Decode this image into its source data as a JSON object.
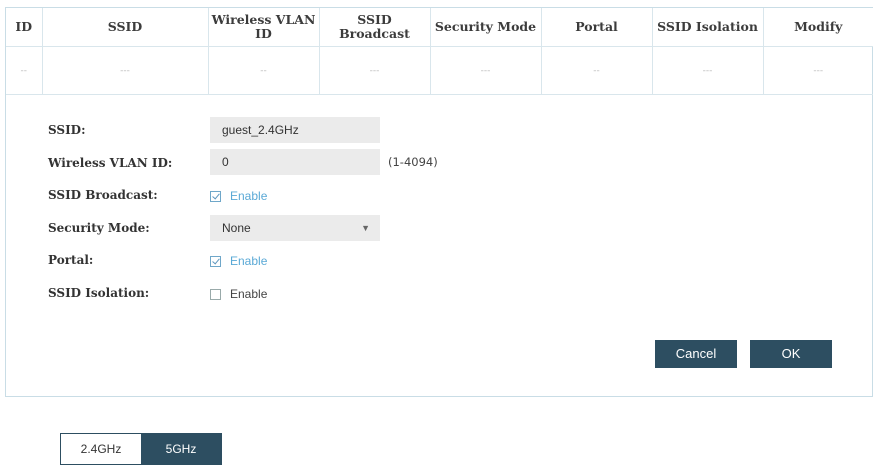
{
  "table": {
    "headers": [
      "ID",
      "SSID",
      "Wireless VLAN ID",
      "SSID Broadcast",
      "Security Mode",
      "Portal",
      "SSID Isolation",
      "Modify"
    ],
    "row": [
      "--",
      "---",
      "--",
      "---",
      "---",
      "--",
      "---",
      "---"
    ]
  },
  "form": {
    "ssid_label": "SSID:",
    "ssid_value": "guest_2.4GHz",
    "vlan_label": "Wireless VLAN ID:",
    "vlan_value": "0",
    "vlan_range": "(1-4094)",
    "broadcast_label": "SSID Broadcast:",
    "broadcast_checked": true,
    "broadcast_text": "Enable",
    "security_label": "Security Mode:",
    "security_value": "None",
    "portal_label": "Portal:",
    "portal_checked": true,
    "portal_text": "Enable",
    "isolation_label": "SSID Isolation:",
    "isolation_checked": false,
    "isolation_text": "Enable"
  },
  "buttons": {
    "cancel": "Cancel",
    "ok": "OK"
  },
  "bands": {
    "tab_24": "2.4GHz",
    "tab_5": "5GHz",
    "active": "5GHz"
  },
  "colors": {
    "accent": "#2d4e61",
    "link": "#5aa9d6",
    "border": "#c9dde6"
  }
}
